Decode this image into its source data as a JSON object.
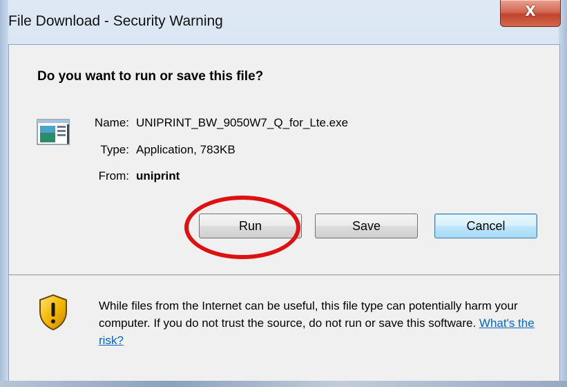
{
  "window": {
    "title": "File Download - Security Warning",
    "close_glyph": "X"
  },
  "dialog": {
    "question": "Do you want to run or save this file?",
    "fields": [
      {
        "label": "Name:",
        "value": "UNIPRINT_BW_9050W7_Q_for_Lte.exe"
      },
      {
        "label": "Type:",
        "value": "Application, 783KB"
      },
      {
        "label": "From:",
        "value": "uniprint"
      }
    ],
    "buttons": {
      "run": "Run",
      "save": "Save",
      "cancel": "Cancel"
    },
    "warning": {
      "text": "While files from the Internet can be useful, this file type can potentially harm your computer. If you do not trust the source, do not run or save this software. ",
      "link": "What's the risk?"
    }
  },
  "icons": {
    "file": "application-file-icon",
    "warning": "security-shield-icon",
    "close": "close-icon"
  },
  "colors": {
    "highlight": "#e01010",
    "link": "#0066cc",
    "close_button": "#c0442d",
    "default_button_border": "#3c7fb1"
  }
}
